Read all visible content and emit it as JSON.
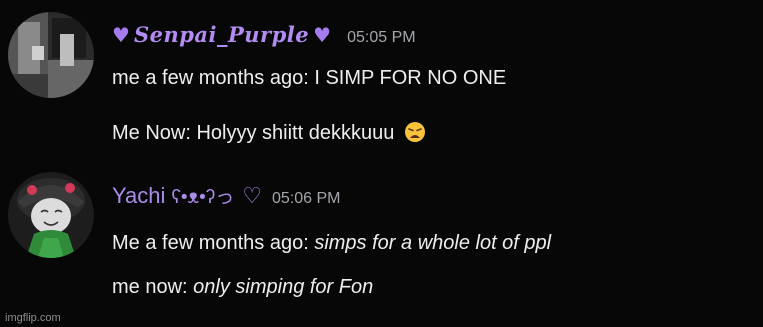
{
  "messages": [
    {
      "username": "Senpai_Purple",
      "username_color": "#b28cf2",
      "timestamp": "05:05 PM",
      "lines": [
        {
          "text": "me a few months ago: I SIMP FOR NO ONE"
        },
        {
          "text": "Me Now: Holyyy shiitt dekkkuuu",
          "emoji": "weary-face-emoji"
        }
      ]
    },
    {
      "username": "Yachi",
      "username_suffix": "ʕ•ᴥ•ʔっ",
      "username_color": "#a98be8",
      "timestamp": "05:06 PM",
      "lines": [
        {
          "prefix": "Me a few months ago: ",
          "italic": "simps for a whole lot of ppl"
        },
        {
          "prefix": "me now: ",
          "italic": "only simping for Fon"
        }
      ]
    }
  ],
  "icons": {
    "heart_solid": "♥",
    "heart_outline": "♡"
  },
  "watermark": "imgflip.com"
}
